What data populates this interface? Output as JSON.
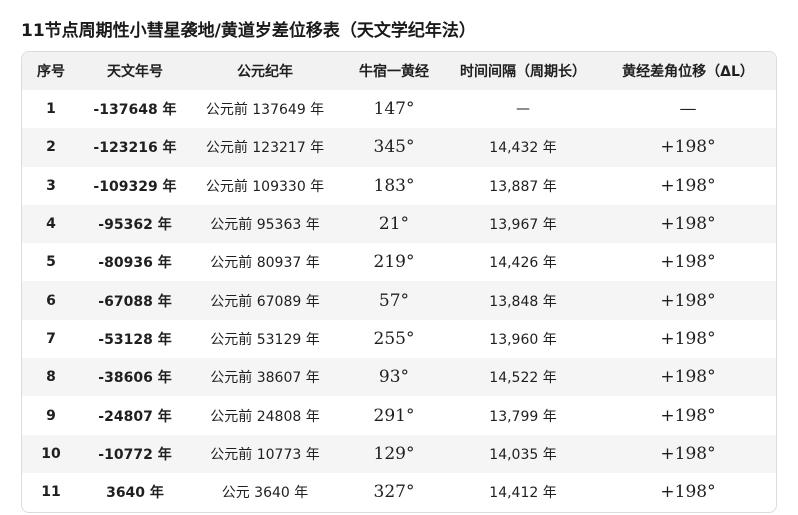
{
  "title": "11节点周期性小彗星袭地/黄道岁差位移表（天文学纪年法）",
  "headers": [
    "序号",
    "天文年号",
    "公元纪年",
    "牛宿一黄经",
    "时间间隔（周期长）",
    "黄经差角位移（ΔL）"
  ],
  "rows": [
    {
      "idx": "1",
      "astro": "-137648 年",
      "ce": "公元前 137649 年",
      "lon": "147°",
      "gap": "—",
      "dl": "—"
    },
    {
      "idx": "2",
      "astro": "-123216 年",
      "ce": "公元前 123217 年",
      "lon": "345°",
      "gap": "14,432 年",
      "dl": "+198°"
    },
    {
      "idx": "3",
      "astro": "-109329 年",
      "ce": "公元前 109330 年",
      "lon": "183°",
      "gap": "13,887 年",
      "dl": "+198°"
    },
    {
      "idx": "4",
      "astro": "-95362 年",
      "ce": "公元前 95363 年",
      "lon": "21°",
      "gap": "13,967 年",
      "dl": "+198°"
    },
    {
      "idx": "5",
      "astro": "-80936 年",
      "ce": "公元前 80937 年",
      "lon": "219°",
      "gap": "14,426 年",
      "dl": "+198°"
    },
    {
      "idx": "6",
      "astro": "-67088 年",
      "ce": "公元前 67089 年",
      "lon": "57°",
      "gap": "13,848 年",
      "dl": "+198°"
    },
    {
      "idx": "7",
      "astro": "-53128 年",
      "ce": "公元前 53129 年",
      "lon": "255°",
      "gap": "13,960 年",
      "dl": "+198°"
    },
    {
      "idx": "8",
      "astro": "-38606 年",
      "ce": "公元前 38607 年",
      "lon": "93°",
      "gap": "14,522 年",
      "dl": "+198°"
    },
    {
      "idx": "9",
      "astro": "-24807 年",
      "ce": "公元前 24808 年",
      "lon": "291°",
      "gap": "13,799 年",
      "dl": "+198°"
    },
    {
      "idx": "10",
      "astro": "-10772 年",
      "ce": "公元前 10773 年",
      "lon": "129°",
      "gap": "14,035 年",
      "dl": "+198°"
    },
    {
      "idx": "11",
      "astro": "3640 年",
      "ce": "公元 3640 年",
      "lon": "327°",
      "gap": "14,412 年",
      "dl": "+198°"
    }
  ]
}
